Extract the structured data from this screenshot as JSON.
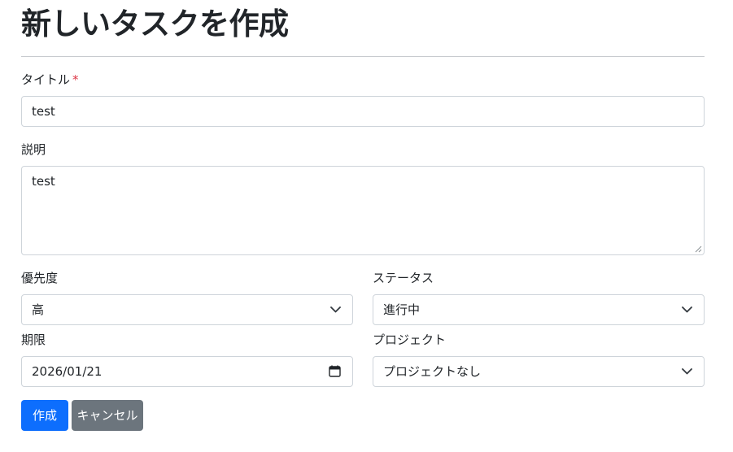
{
  "page": {
    "title": "新しいタスクを作成"
  },
  "form": {
    "title_field": {
      "label": "タイトル",
      "required_mark": "*",
      "value": "test"
    },
    "description_field": {
      "label": "説明",
      "value": "test"
    },
    "priority_field": {
      "label": "優先度",
      "selected": "高"
    },
    "status_field": {
      "label": "ステータス",
      "selected": "進行中"
    },
    "due_field": {
      "label": "期限",
      "value": "2026/01/21"
    },
    "project_field": {
      "label": "プロジェクト",
      "selected": "プロジェクトなし"
    },
    "buttons": {
      "submit_label": "作成",
      "cancel_label": "キャンセル"
    }
  },
  "colors": {
    "primary": "#0d6efd",
    "secondary": "#6c757d",
    "required": "#dc3545",
    "border": "#ced4da"
  },
  "icons": {
    "select_arrow": "chevron-down-icon",
    "date_picker": "calendar-icon",
    "textarea_resize": "resize-grip-icon"
  }
}
